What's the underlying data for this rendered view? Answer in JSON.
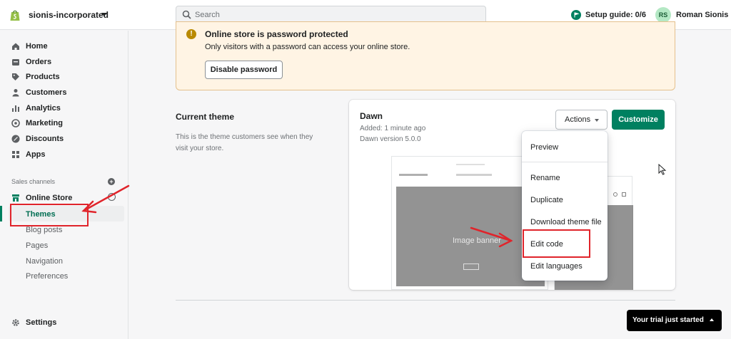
{
  "topbar": {
    "store_name": "sionis-incorporated",
    "search_placeholder": "Search",
    "setup_guide": "Setup guide: 0/6",
    "avatar_initials": "RS",
    "user_name": "Roman Sionis"
  },
  "sidebar": {
    "items": [
      {
        "label": "Home",
        "icon": "home-icon"
      },
      {
        "label": "Orders",
        "icon": "orders-icon"
      },
      {
        "label": "Products",
        "icon": "tag-icon"
      },
      {
        "label": "Customers",
        "icon": "person-icon"
      },
      {
        "label": "Analytics",
        "icon": "bar-chart-icon"
      },
      {
        "label": "Marketing",
        "icon": "target-icon"
      },
      {
        "label": "Discounts",
        "icon": "discount-icon"
      },
      {
        "label": "Apps",
        "icon": "apps-icon"
      }
    ],
    "sales_channels_title": "Sales channels",
    "online_store": "Online Store",
    "online_store_subitems": [
      "Themes",
      "Blog posts",
      "Pages",
      "Navigation",
      "Preferences"
    ],
    "settings": "Settings"
  },
  "banner": {
    "title": "Online store is password protected",
    "text": "Only visitors with a password can access your online store.",
    "button": "Disable password"
  },
  "current_theme": {
    "heading": "Current theme",
    "description": "This is the theme customers see when they visit your store."
  },
  "theme_card": {
    "name": "Dawn",
    "added": "Added: 1 minute ago",
    "version": "Dawn version 5.0.0",
    "actions_button": "Actions",
    "customize_button": "Customize",
    "preview_label": "Image banner"
  },
  "actions_menu": {
    "items": [
      "Preview",
      "Rename",
      "Duplicate",
      "Download theme file",
      "Edit code",
      "Edit languages"
    ]
  },
  "toast": {
    "text": "Your trial just started"
  },
  "colors": {
    "brand_green": "#008060",
    "warning_bg": "#fff4e4",
    "annotation_red": "#e0242b"
  }
}
